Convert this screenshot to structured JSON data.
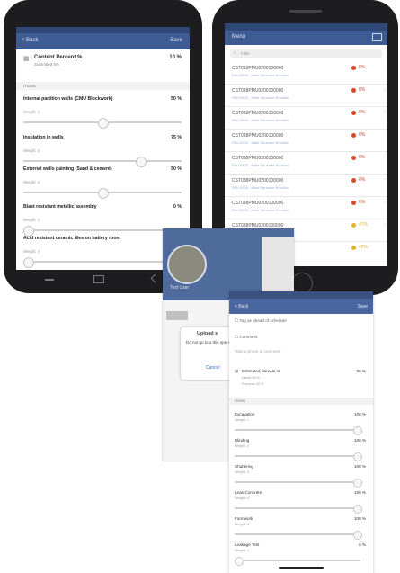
{
  "phone1": {
    "back_label": "< Back",
    "save_label": "Save",
    "content_percent": {
      "label": "Content Percent %",
      "sub": "Submitted 5%",
      "value": "10 %"
    },
    "section_label": "ITEMS",
    "items": [
      {
        "name": "Internal partition walls (CMU Blockwork)",
        "value": "50 %",
        "weight": "Weight: 4",
        "level": 0.5
      },
      {
        "name": "Insulation in walls",
        "value": "75 %",
        "weight": "Weight: 3",
        "level": 0.75
      },
      {
        "name": "External walls painting (Sand & cement)",
        "value": "50 %",
        "weight": "Weight: 4",
        "level": 0.5
      },
      {
        "name": "Blast resistant metallic assembly",
        "value": "0 %",
        "weight": "Weight: 4",
        "level": 0.0
      },
      {
        "name": "Acid resistant ceramic tiles on battery room",
        "value": "",
        "weight": "Weight: 4",
        "level": 0.0
      }
    ]
  },
  "phone2": {
    "title": "Menu",
    "search_placeholder": "Filter",
    "rows": [
      {
        "code": "CST038PMU0200100000",
        "desc": "PAU 0000 - Main Structure Erection",
        "pct": "0%",
        "color": "#d9472b"
      },
      {
        "code": "CST038PMU0200100000",
        "desc": "PAU 0000 - Main Structure Erection",
        "pct": "0%",
        "color": "#d9472b"
      },
      {
        "code": "CST038PMU0200100000",
        "desc": "PAU 0000 - Main Structure Erection",
        "pct": "0%",
        "color": "#d9472b"
      },
      {
        "code": "CST038PMU0200100000",
        "desc": "PAU 0000 - Main Structure Erection",
        "pct": "0%",
        "color": "#d9472b"
      },
      {
        "code": "CST038PMU0200100000",
        "desc": "PAU 0000 - Main Structure Erection",
        "pct": "0%",
        "color": "#d9472b"
      },
      {
        "code": "CST038PMU0200100000",
        "desc": "PAU 0000 - Main Structure Erection",
        "pct": "0%",
        "color": "#d9472b"
      },
      {
        "code": "CST038PMU0200100000",
        "desc": "PAU 0000 - Main Structure Erection",
        "pct": "0%",
        "color": "#d9472b"
      },
      {
        "code": "CST038PMU0200100000",
        "desc": "PAU 0000 - Main Structure Erection",
        "pct": "47%",
        "color": "#e2b12c"
      },
      {
        "code": "CST038PMU0200100000",
        "desc": "PAU 0000 - Main Structure Erection",
        "pct": "42%",
        "color": "#e2b12c"
      }
    ]
  },
  "middle": {
    "name": "Test User",
    "dialog_title": "Upload s",
    "dialog_body": "Do not go to o this operation has",
    "dialog_cancel": "Cancel"
  },
  "phone3": {
    "back_label": "< Back",
    "save_label": "Save",
    "option1": "Tag as ahead of schedule",
    "option2": "Comment",
    "option3": "Take a photo to comment",
    "summary_label": "Estimated Percent %",
    "summary_value": "55 %",
    "summary_sub1": "Latest 45 %",
    "summary_sub2": "Previous 30 %",
    "section_label": "ITEMS",
    "items": [
      {
        "name": "Excavation",
        "value": "100 %",
        "weight": "Weight: 1",
        "level": 1.0
      },
      {
        "name": "Blinding",
        "value": "100 %",
        "weight": "Weight: 2",
        "level": 1.0
      },
      {
        "name": "Shuttering",
        "value": "100 %",
        "weight": "Weight: 3",
        "level": 1.0
      },
      {
        "name": "Lean Concrete",
        "value": "100 %",
        "weight": "Weight: 4",
        "level": 1.0
      },
      {
        "name": "Formwork",
        "value": "100 %",
        "weight": "Weight: 4",
        "level": 1.0
      },
      {
        "name": "Leakage Test",
        "value": "0 %",
        "weight": "Weight: 1",
        "level": 0.0
      }
    ]
  }
}
